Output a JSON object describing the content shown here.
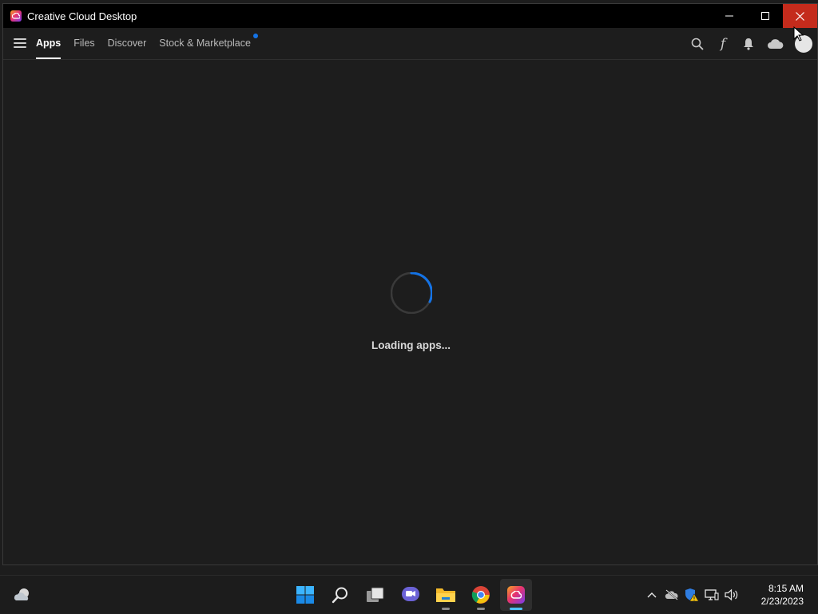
{
  "window": {
    "title": "Creative Cloud Desktop",
    "icon": "creative-cloud-icon",
    "controls": [
      "minimize-icon",
      "maximize-icon",
      "close-icon"
    ],
    "close_hover_color": "#c42b1c"
  },
  "navbar": {
    "menu_icon": "hamburger-menu-icon",
    "tabs": [
      {
        "label": "Apps",
        "active": true
      },
      {
        "label": "Files",
        "active": false
      },
      {
        "label": "Discover",
        "active": false
      },
      {
        "label": "Stock & Marketplace",
        "active": false,
        "notification": true
      }
    ],
    "icons": [
      "search-icon",
      "fonts-icon",
      "bell-icon",
      "cloud-icon",
      "avatar"
    ],
    "notification_color": "#1473e6"
  },
  "main": {
    "loading_text": "Loading apps...",
    "spinner_accent": "#1473e6"
  },
  "taskbar": {
    "apps": [
      "windows-start-icon",
      "search-icon",
      "task-view-icon",
      "teams-chat-icon",
      "file-explorer-icon",
      "chrome-icon",
      "creative-cloud-icon"
    ],
    "tray_icons": [
      "chevron-up-icon",
      "onedrive-icon",
      "security-warning-icon",
      "network-icon",
      "volume-icon"
    ],
    "time": "8:15 AM",
    "date": "2/23/2023"
  }
}
